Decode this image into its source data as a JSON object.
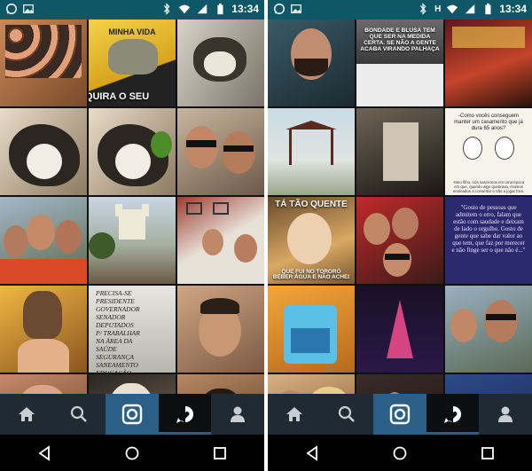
{
  "status_bar": {
    "time": "13:34",
    "carrier_indicator": "H"
  },
  "left_panel": {
    "tiles": [
      {
        "caption": "ADQUIRA O SEU",
        "subcaption": "MINHA VIDA"
      },
      {
        "caption": ""
      },
      {
        "caption": ""
      },
      {
        "caption": ""
      },
      {
        "caption": ""
      },
      {
        "caption": ""
      },
      {
        "caption": ""
      },
      {
        "caption": ""
      },
      {
        "caption": ""
      },
      {
        "caption": ""
      },
      {
        "sign_text": "PRECISA-SE\nPRESIDENTE\nGOVERNADOR\nSENADOR\nDEPUTADOS\nP/ TRABALHAR\nNA ÁREA DA\nSAÚDE\nSEGURANÇA\nSANEAMENTO\nEDUCAÇÃO\nO POVO PAGA BEM"
      },
      {
        "caption": ""
      },
      {
        "caption": ""
      },
      {
        "caption": ""
      },
      {
        "caption": ""
      }
    ]
  },
  "right_panel": {
    "tiles": [
      {
        "caption": ""
      },
      {
        "caption": "BONDADE E BLUSA TEM QUE SER NA MEDIDA CERTA. SE NÃO A GENTE ACABA VIRANDO PALHAÇA"
      },
      {
        "caption": ""
      },
      {
        "caption": ""
      },
      {
        "caption": ""
      },
      {
        "note": "-Como vocês conseguem manter um casamento que já dura 65 anos?",
        "footer": "-Meu filho, nós nascemos em uma época em que, quando algo quebrava, éramos ensinados a consertar e não a jogar fora."
      },
      {
        "caption_top": "TÁ TÃO QUENTE",
        "caption_bottom": "QUE FUI NO TORORÓ BEBER ÁGUA E NÃO ACHEI"
      },
      {
        "caption": ""
      },
      {
        "note": "\"Gosto de pessoas que admitem o erro, falam que estão com saudade e deixam de lado o orgulho. Gosto de gente que sabe dar valor ao que tem, que faz por merecer e não finge ser o que não é...\""
      },
      {
        "caption": ""
      },
      {
        "caption": ""
      },
      {
        "caption": ""
      },
      {
        "caption": ""
      },
      {
        "caption": ""
      },
      {
        "caption": ""
      }
    ]
  },
  "nav": {
    "items": [
      "home",
      "explore",
      "camera",
      "news",
      "profile"
    ],
    "active": "camera"
  },
  "colors": {
    "status_bar": "#0d5766",
    "nav_bar": "#1f2a33",
    "nav_active": "#2a6088",
    "sys_nav": "#000000"
  },
  "icons": [
    "whatsapp-icon",
    "image-icon",
    "bluetooth-icon",
    "wifi-icon",
    "signal-icon",
    "battery-icon",
    "home-icon",
    "search-icon",
    "camera-icon",
    "heart-bubble-icon",
    "person-icon",
    "back-icon",
    "home-circle-icon",
    "recents-icon"
  ]
}
